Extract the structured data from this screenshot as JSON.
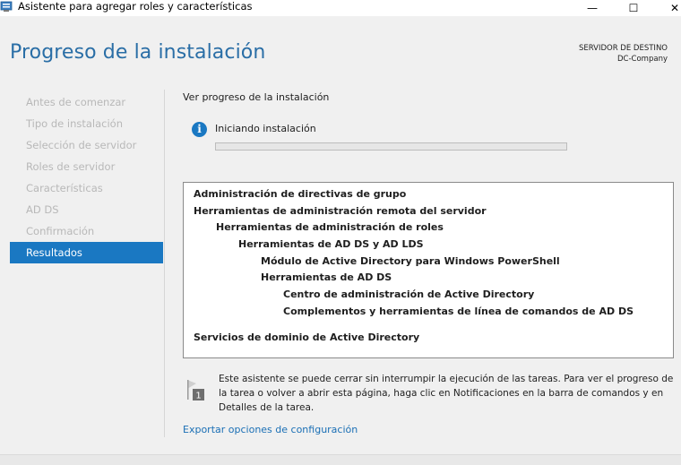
{
  "window": {
    "title": "Asistente para agregar roles y características",
    "controls": {
      "minimize": "—",
      "maximize": "☐",
      "close": "✕"
    }
  },
  "header": {
    "title": "Progreso de la instalación",
    "server_label": "SERVIDOR DE DESTINO",
    "server_name": "DC-Company"
  },
  "nav": {
    "items": [
      {
        "label": "Antes de comenzar",
        "state": "disabled"
      },
      {
        "label": "Tipo de instalación",
        "state": "disabled"
      },
      {
        "label": "Selección de servidor",
        "state": "disabled"
      },
      {
        "label": "Roles de servidor",
        "state": "disabled"
      },
      {
        "label": "Características",
        "state": "disabled"
      },
      {
        "label": "AD DS",
        "state": "disabled"
      },
      {
        "label": "Confirmación",
        "state": "disabled"
      },
      {
        "label": "Resultados",
        "state": "active"
      }
    ]
  },
  "main": {
    "sub_heading": "Ver progreso de la instalación",
    "status_icon": "info-icon",
    "status_text": "Iniciando instalación",
    "progress": 0,
    "results": [
      {
        "label": "Administración de directivas de grupo",
        "level": 0
      },
      {
        "label": "Herramientas de administración remota del servidor",
        "level": 0
      },
      {
        "label": "Herramientas de administración de roles",
        "level": 1
      },
      {
        "label": "Herramientas de AD DS y AD LDS",
        "level": 2
      },
      {
        "label": "Módulo de Active Directory para Windows PowerShell",
        "level": 3
      },
      {
        "label": "Herramientas de AD DS",
        "level": 3
      },
      {
        "label": "Centro de administración de Active Directory",
        "level": 4
      },
      {
        "label": "Complementos y herramientas de línea de comandos de AD DS",
        "level": 4
      },
      {
        "label": "Servicios de dominio de Active Directory",
        "level": 0
      }
    ],
    "note": "Este asistente se puede cerrar sin interrumpir la ejecución de las tareas. Para ver el progreso de la tarea o volver a abrir esta página, haga clic en Notificaciones en la barra de comandos y en Detalles de la tarea.",
    "note_icon": "notification-flag-icon",
    "note_icon_badge": "1",
    "export_link": "Exportar opciones de configuración"
  },
  "colors": {
    "accent": "#1a78c2",
    "title": "#2a6ea6",
    "link": "#1a6fb5",
    "nav_disabled": "#b8b8b8"
  }
}
